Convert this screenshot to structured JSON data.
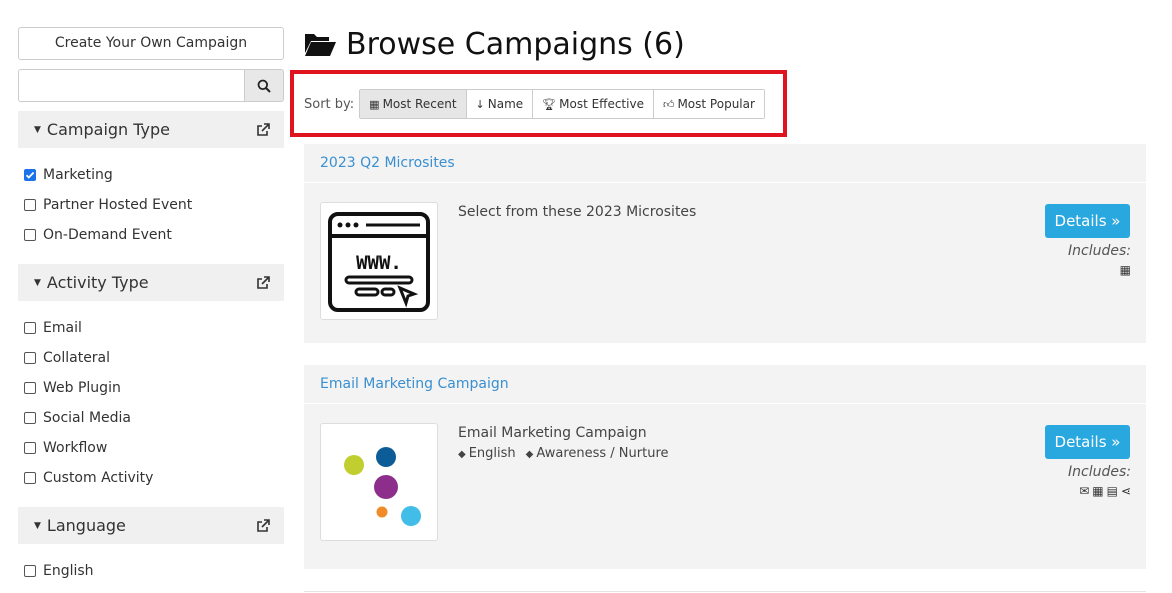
{
  "sidebar": {
    "create_label": "Create Your Own Campaign",
    "search": {
      "value": "",
      "placeholder": ""
    },
    "facets": [
      {
        "title": "Campaign Type",
        "items": [
          {
            "label": "Marketing",
            "checked": true
          },
          {
            "label": "Partner Hosted Event",
            "checked": false
          },
          {
            "label": "On-Demand Event",
            "checked": false
          }
        ]
      },
      {
        "title": "Activity Type",
        "items": [
          {
            "label": "Email",
            "checked": false
          },
          {
            "label": "Collateral",
            "checked": false
          },
          {
            "label": "Web Plugin",
            "checked": false
          },
          {
            "label": "Social Media",
            "checked": false
          },
          {
            "label": "Workflow",
            "checked": false
          },
          {
            "label": "Custom Activity",
            "checked": false
          }
        ]
      },
      {
        "title": "Language",
        "items": [
          {
            "label": "English",
            "checked": false
          }
        ]
      }
    ]
  },
  "main": {
    "title": "Browse Campaigns (6)",
    "sort_label": "Sort by:",
    "sort_options": [
      {
        "label": "Most Recent",
        "icon": "calendar-icon",
        "active": true
      },
      {
        "label": "Name",
        "icon": "sort-alpha-icon",
        "active": false
      },
      {
        "label": "Most Effective",
        "icon": "trophy-icon",
        "active": false
      },
      {
        "label": "Most Popular",
        "icon": "thumbs-up-icon",
        "active": false
      }
    ],
    "campaigns": [
      {
        "name": "2023 Q2 Microsites",
        "description": "Select from these 2023 Microsites",
        "tags": [],
        "details_label": "Details »",
        "includes_label": "Includes:",
        "includes_icons": [
          "grid-icon"
        ]
      },
      {
        "name": "Email Marketing Campaign",
        "description": "Email Marketing Campaign",
        "tags": [
          "English",
          "Awareness / Nurture"
        ],
        "details_label": "Details »",
        "includes_label": "Includes:",
        "includes_icons": [
          "envelope-icon",
          "grid-icon",
          "document-icon",
          "share-icon"
        ]
      }
    ]
  },
  "colors": {
    "accent": "#29a8e0",
    "link": "#3a8fd0",
    "highlight": "#e0141e",
    "checkbox": "#1a73e8"
  }
}
